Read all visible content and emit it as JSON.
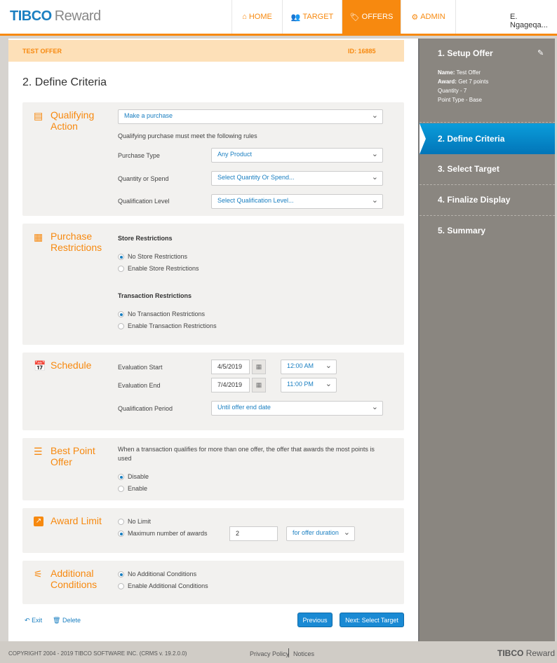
{
  "header": {
    "brand": "TIBCO",
    "product": "Reward",
    "nav": [
      {
        "label": "HOME",
        "icon": "home-icon"
      },
      {
        "label": "TARGET",
        "icon": "users-icon"
      },
      {
        "label": "OFFERS",
        "icon": "tags-icon"
      },
      {
        "label": "ADMIN",
        "icon": "gears-icon"
      }
    ],
    "user": "E. Ngageqa..."
  },
  "offer": {
    "name": "TEST OFFER",
    "id": "ID: 16885"
  },
  "page_title": "2. Define Criteria",
  "qualifying": {
    "title": "Qualifying Action",
    "action": "Make a purchase",
    "note": "Qualifying purchase must meet the following rules",
    "rows": [
      {
        "label": "Purchase Type",
        "value": "Any Product"
      },
      {
        "label": "Quantity or Spend",
        "value": "Select Quantity Or Spend..."
      },
      {
        "label": "Qualification Level",
        "value": "Select Qualification Level..."
      }
    ]
  },
  "purchase": {
    "title": "Purchase Restrictions",
    "store_heading": "Store Restrictions",
    "store_options": [
      "No Store Restrictions",
      "Enable Store Restrictions"
    ],
    "txn_heading": "Transaction Restrictions",
    "txn_options": [
      "No Transaction Restrictions",
      "Enable Transaction Restrictions"
    ]
  },
  "schedule": {
    "title": "Schedule",
    "start_label": "Evaluation Start",
    "start_date": "4/5/2019",
    "start_time": "12:00 AM",
    "end_label": "Evaluation End",
    "end_date": "7/4/2019",
    "end_time": "11:00 PM",
    "period_label": "Qualification Period",
    "period_value": "Until offer end date"
  },
  "best_point": {
    "title": "Best Point Offer",
    "description": "When a transaction qualifies for more than one offer, the offer that awards the most points is used",
    "options": [
      "Disable",
      "Enable"
    ]
  },
  "award_limit": {
    "title": "Award Limit",
    "options": [
      "No Limit",
      "Maximum number of awards"
    ],
    "max_value": "2",
    "duration": "for offer duration"
  },
  "additional": {
    "title": "Additional Conditions",
    "options": [
      "No Additional Conditions",
      "Enable Additional Conditions"
    ]
  },
  "actions": {
    "exit": "Exit",
    "delete": "Delete",
    "previous": "Previous",
    "next": "Next: Select Target"
  },
  "sidebar": {
    "step1": "1. Setup Offer",
    "details": [
      {
        "k": "Name:",
        "v": "Test Offer"
      },
      {
        "k": "Award:",
        "v": "Get 7 points"
      }
    ],
    "lines": [
      "Quantity - 7",
      "Point Type - Base"
    ],
    "step2": "2. Define Criteria",
    "step3": "3. Select Target",
    "step4": "4. Finalize Display",
    "step5": "5. Summary"
  },
  "footer": {
    "copyright": "COPYRIGHT 2004 - 2019 TIBCO SOFTWARE INC. (CRMS v. 19.2.0.0)",
    "privacy": "Privacy Policy",
    "notices": "Notices",
    "brand": "TIBCO",
    "product": "Reward"
  },
  "colors": {
    "accent": "#f7890f",
    "primary": "#1a8ad4",
    "sidebar": "#8a8680"
  }
}
